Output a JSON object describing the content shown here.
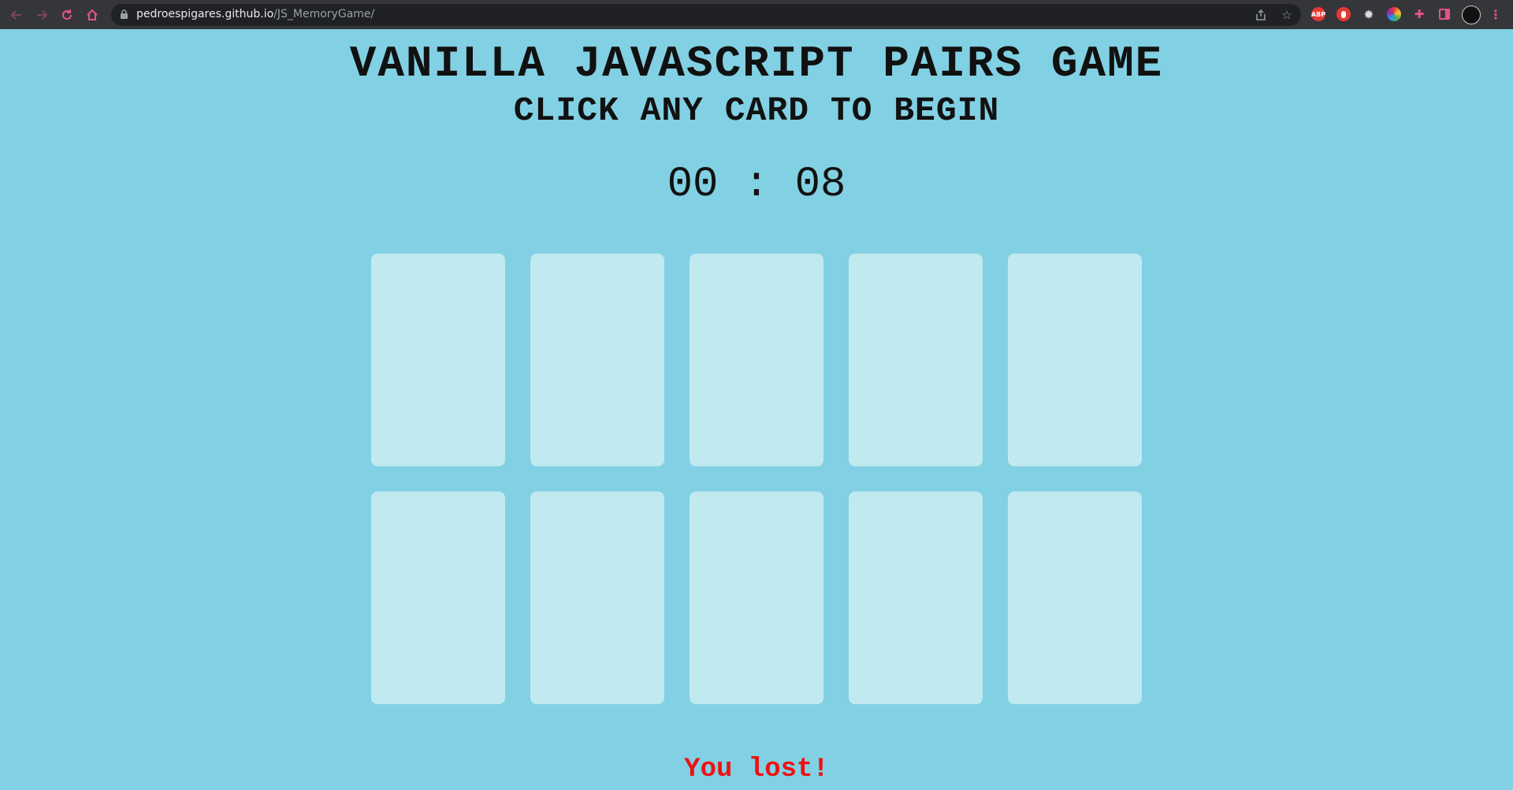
{
  "browser": {
    "url_host": "pedroespigares.github.io",
    "url_path": "/JS_MemoryGame/",
    "nav": {
      "back_icon": "back-arrow-icon",
      "forward_icon": "forward-arrow-icon",
      "reload_icon": "reload-icon",
      "home_icon": "home-icon"
    },
    "extensions": [
      {
        "name": "adblock-plus-icon",
        "label": "ABP",
        "color": "#e53935"
      },
      {
        "name": "hand-extension-icon",
        "label": "",
        "color": "#e53935"
      },
      {
        "name": "gear-extension-icon",
        "label": "",
        "color": "#cfcfcf"
      },
      {
        "name": "color-wheel-extension-icon",
        "label": "",
        "color": "#4caf50"
      },
      {
        "name": "puzzle-extensions-icon",
        "label": "",
        "color": "#e8518b"
      }
    ],
    "accent_color": "#e8518b"
  },
  "game": {
    "title": "VANILLA JAVASCRIPT PAIRS GAME",
    "subtitle": "CLICK ANY CARD TO BEGIN",
    "timer": "00 : 08",
    "result": "You lost!",
    "result_color": "#ee1111",
    "background_color": "#82d0e3",
    "card_color": "#c1e9f0",
    "cards": [
      {
        "id": 1
      },
      {
        "id": 2
      },
      {
        "id": 3
      },
      {
        "id": 4
      },
      {
        "id": 5
      },
      {
        "id": 6
      },
      {
        "id": 7
      },
      {
        "id": 8
      },
      {
        "id": 9
      },
      {
        "id": 10
      }
    ]
  }
}
